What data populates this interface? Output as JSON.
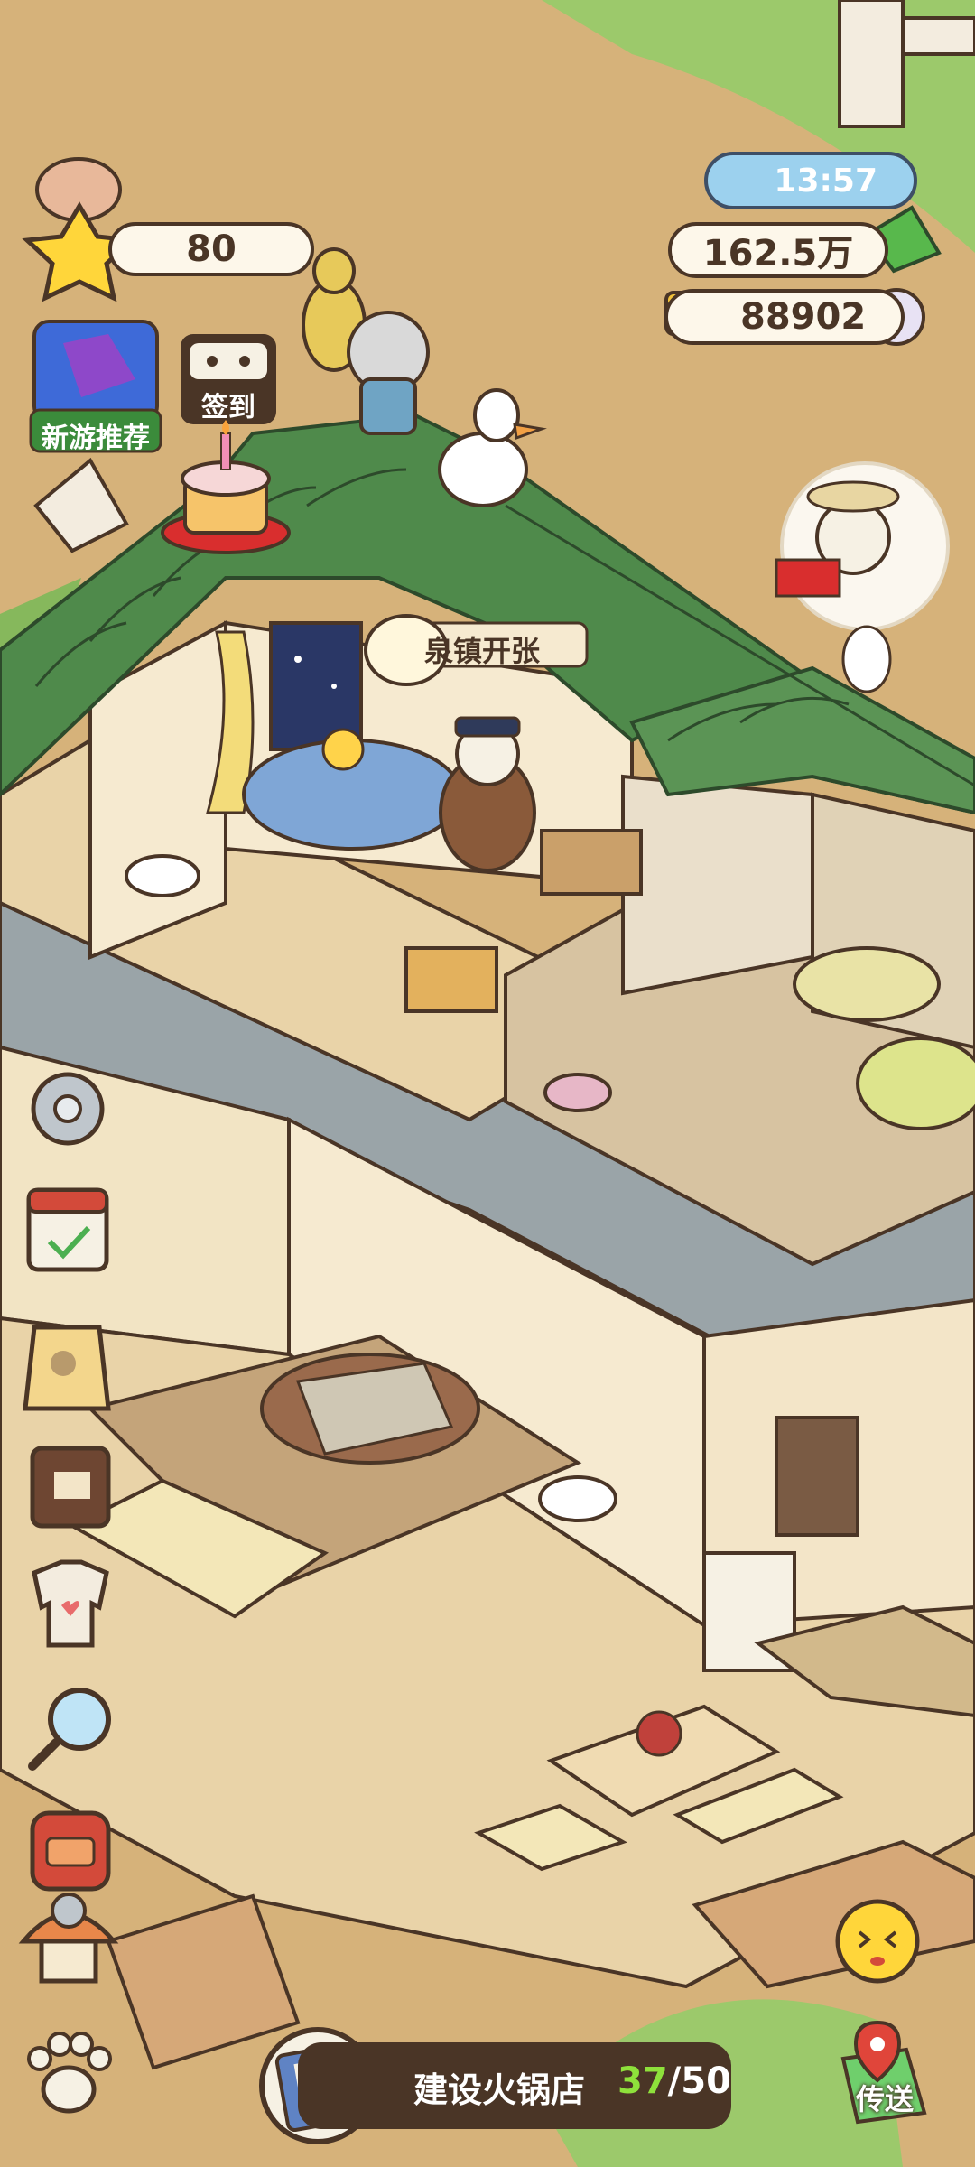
{
  "hud": {
    "level": "80",
    "time": "13:57",
    "money": "162.5万",
    "pearls": "88902"
  },
  "left_buttons": {
    "new_game_label": "新游推荐",
    "checkin_label": "签到"
  },
  "shop_sign": "泉镇开张",
  "quest": {
    "title": "建设火锅店",
    "current": "37",
    "total": "/50"
  },
  "teleport_label": "传送",
  "colors": {
    "roof_green": "#4f8a4b",
    "wall_cream": "#f6ead0",
    "floor_wood": "#e9d3a8",
    "outline": "#4a3526",
    "quest_progress": "#8ee13b"
  },
  "icons": [
    "star-icon",
    "bamboo-cash-icon",
    "pearl-icon",
    "sun-icon",
    "settings-gear-icon",
    "calendar-icon",
    "pet-tag-icon",
    "recipe-book-icon",
    "shirt-icon",
    "magnifier-icon",
    "backpack-icon",
    "mushroom-house-icon",
    "paw-icon",
    "cake-icon",
    "emoji-face-icon",
    "map-pin-icon",
    "quest-scroll-icon"
  ]
}
